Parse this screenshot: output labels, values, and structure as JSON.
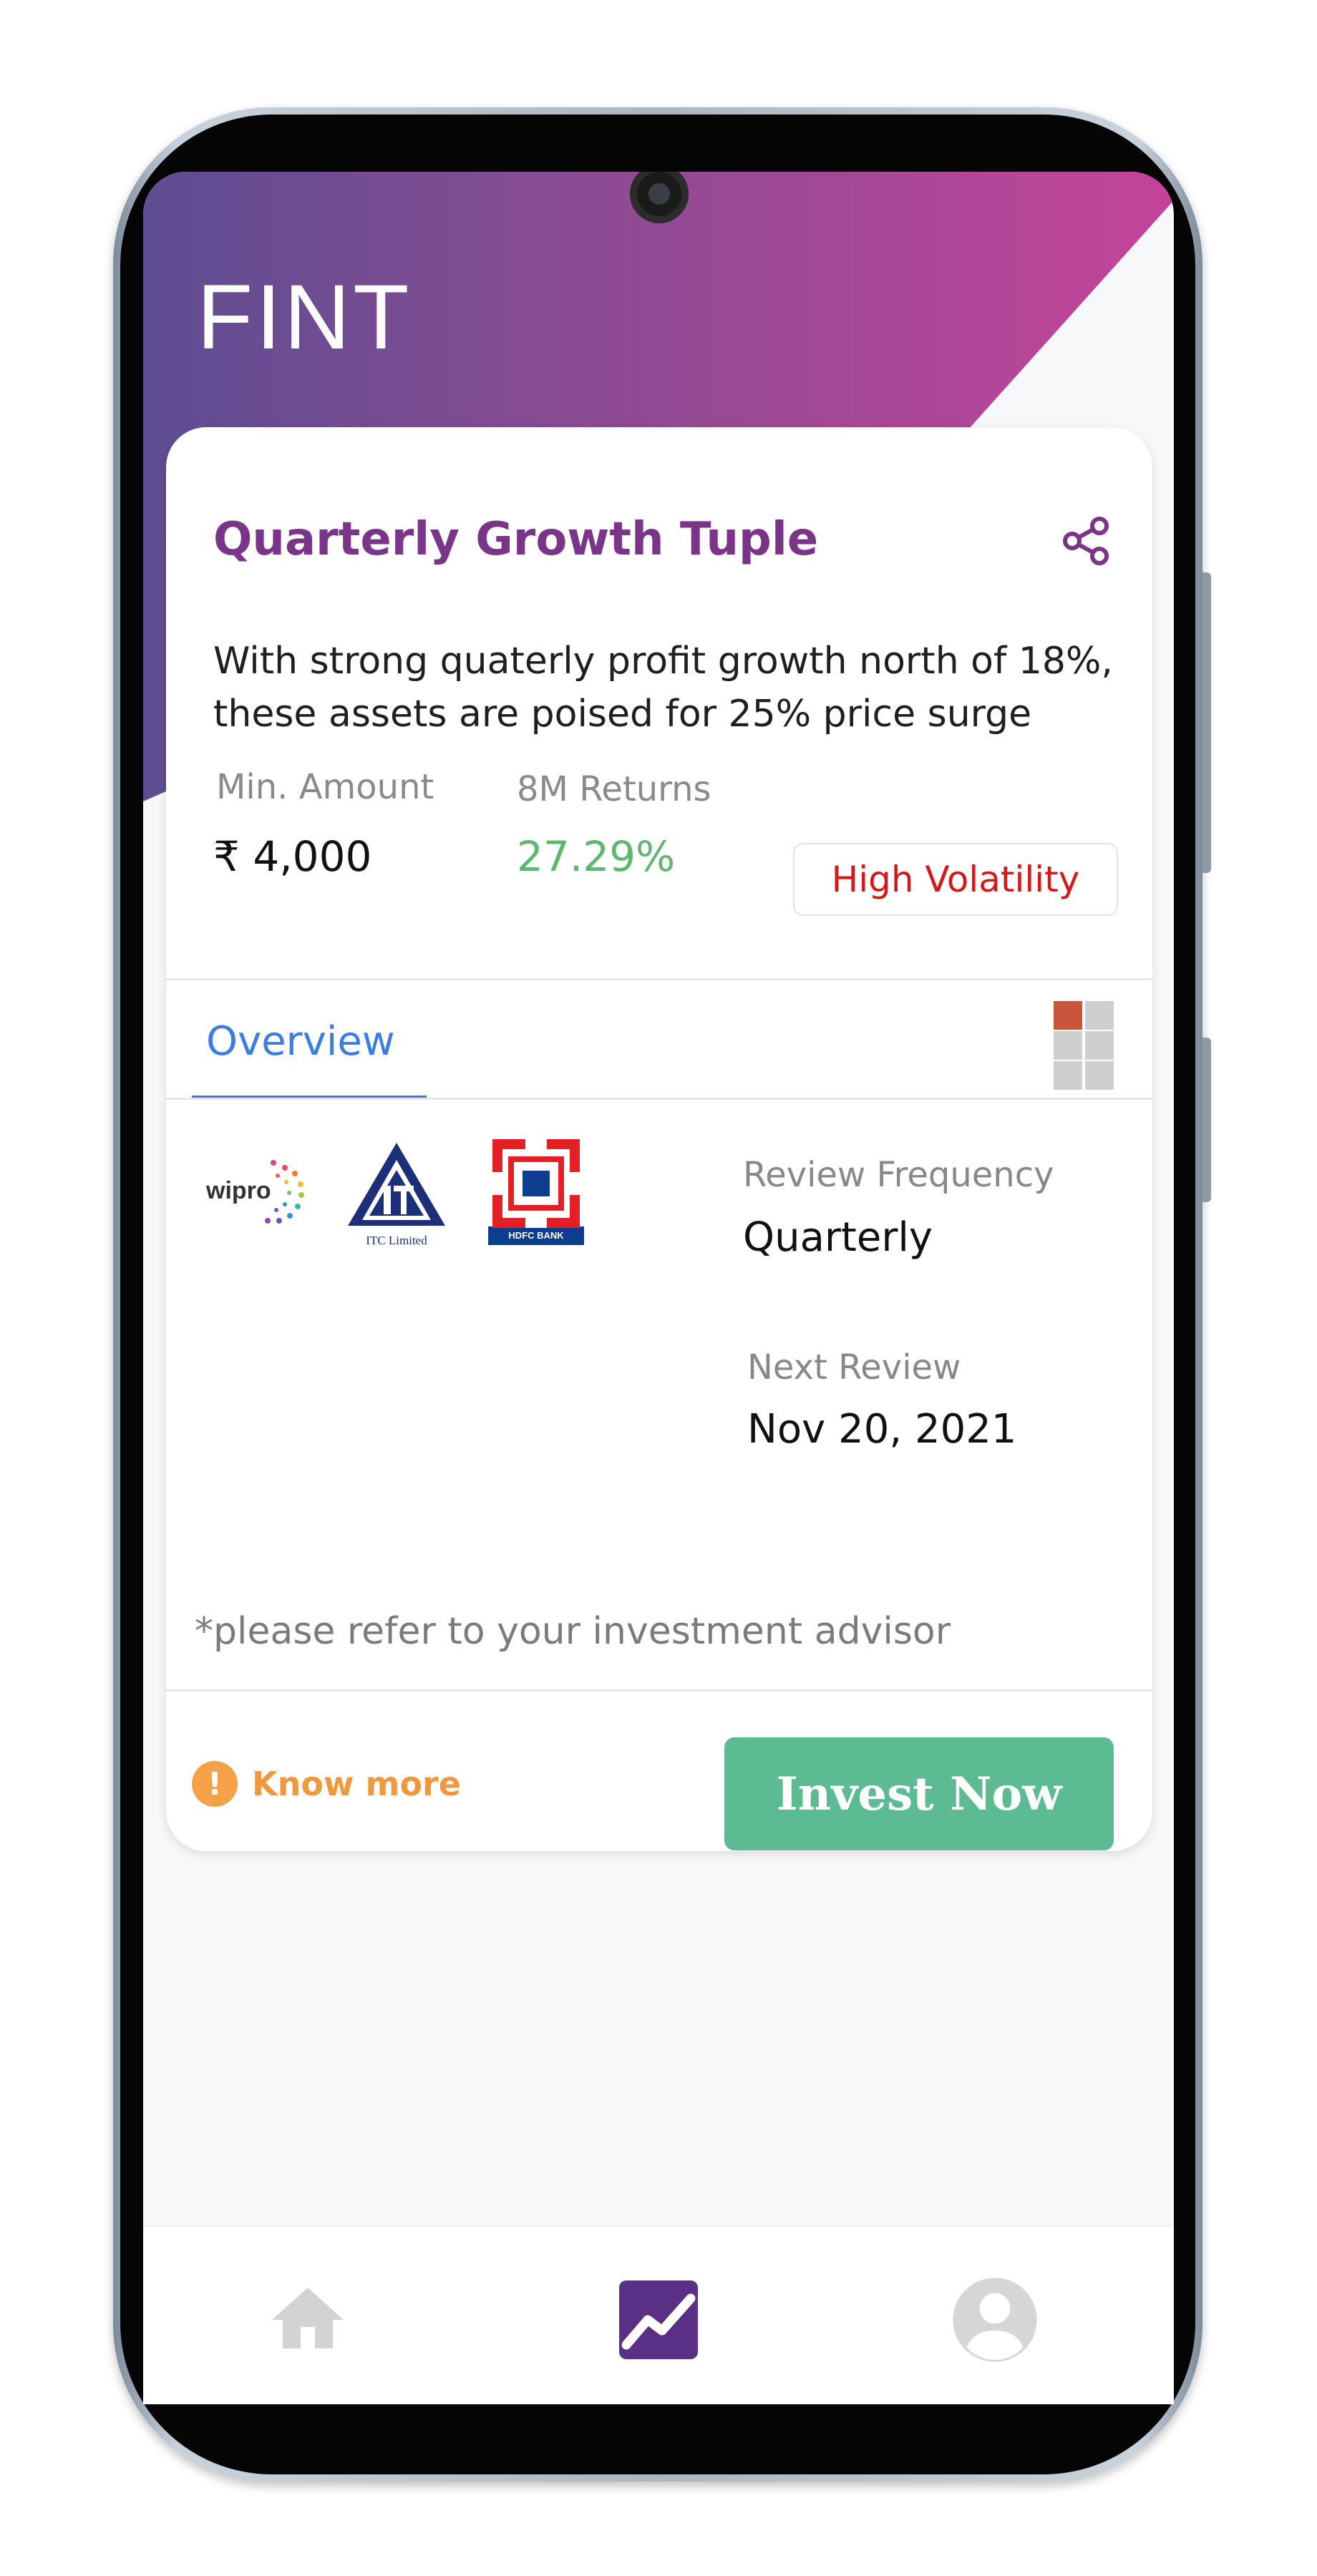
{
  "app": {
    "brand": "FINT"
  },
  "card": {
    "title": "Quarterly Growth Tuple",
    "description": "With strong quaterly profit growth north of 18%, these assets are poised for 25% price surge",
    "min_amount_label": "Min. Amount",
    "min_amount_value": "₹ 4,000",
    "returns_label": "8M Returns",
    "returns_value": "27.29%",
    "volatility_badge": "High Volatility",
    "tab_overview": "Overview",
    "review_frequency_label": "Review Frequency",
    "review_frequency_value": "Quarterly",
    "next_review_label": "Next Review",
    "next_review_value": "Nov 20, 2021",
    "note": "*please refer to your investment advisor",
    "know_more": "Know more",
    "invest_now": "Invest Now"
  },
  "logos": {
    "wipro": "wipro",
    "itc": "ITC Limited",
    "hdfc": "HDFC BANK"
  },
  "nav": {
    "items": [
      "home-icon",
      "chart-icon",
      "profile-icon"
    ],
    "active": "chart-icon"
  },
  "colors": {
    "accent_purple": "#7a3589",
    "returns_green": "#5cb86e",
    "volatility_red": "#d11a1a",
    "invest_button": "#5dbb94",
    "tab_blue": "#3b7de3",
    "know_more_orange": "#f0983e"
  }
}
